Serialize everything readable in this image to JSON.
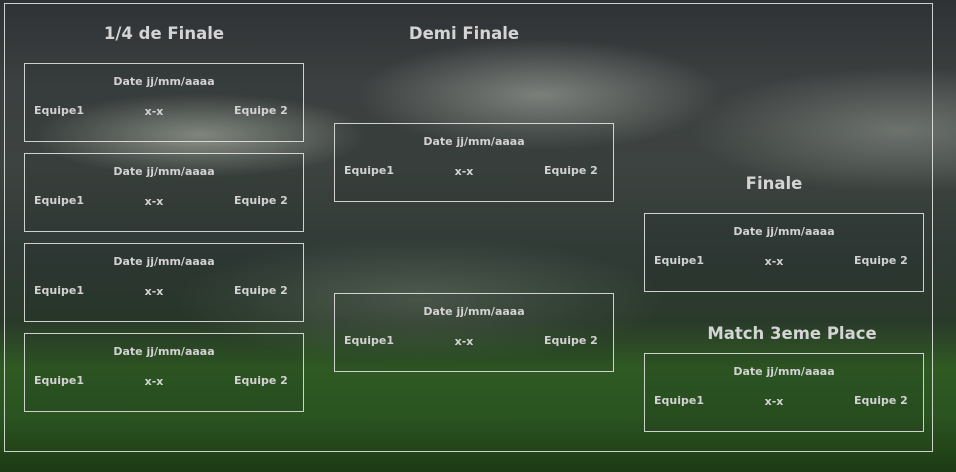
{
  "rounds": {
    "quarter": {
      "title": "1/4 de Finale",
      "matches": [
        {
          "date": "Date jj/mm/aaaa",
          "team1": "Equipe1",
          "score": "x-x",
          "team2": "Equipe 2"
        },
        {
          "date": "Date jj/mm/aaaa",
          "team1": "Equipe1",
          "score": "x-x",
          "team2": "Equipe 2"
        },
        {
          "date": "Date jj/mm/aaaa",
          "team1": "Equipe1",
          "score": "x-x",
          "team2": "Equipe 2"
        },
        {
          "date": "Date jj/mm/aaaa",
          "team1": "Equipe1",
          "score": "x-x",
          "team2": "Equipe 2"
        }
      ]
    },
    "semi": {
      "title": "Demi Finale",
      "matches": [
        {
          "date": "Date jj/mm/aaaa",
          "team1": "Equipe1",
          "score": "x-x",
          "team2": "Equipe 2"
        },
        {
          "date": "Date jj/mm/aaaa",
          "team1": "Equipe1",
          "score": "x-x",
          "team2": "Equipe 2"
        }
      ]
    },
    "final": {
      "title": "Finale",
      "match": {
        "date": "Date jj/mm/aaaa",
        "team1": "Equipe1",
        "score": "x-x",
        "team2": "Equipe 2"
      }
    },
    "third_place": {
      "title": "Match 3eme Place",
      "match": {
        "date": "Date jj/mm/aaaa",
        "team1": "Equipe1",
        "score": "x-x",
        "team2": "Equipe 2"
      }
    }
  }
}
